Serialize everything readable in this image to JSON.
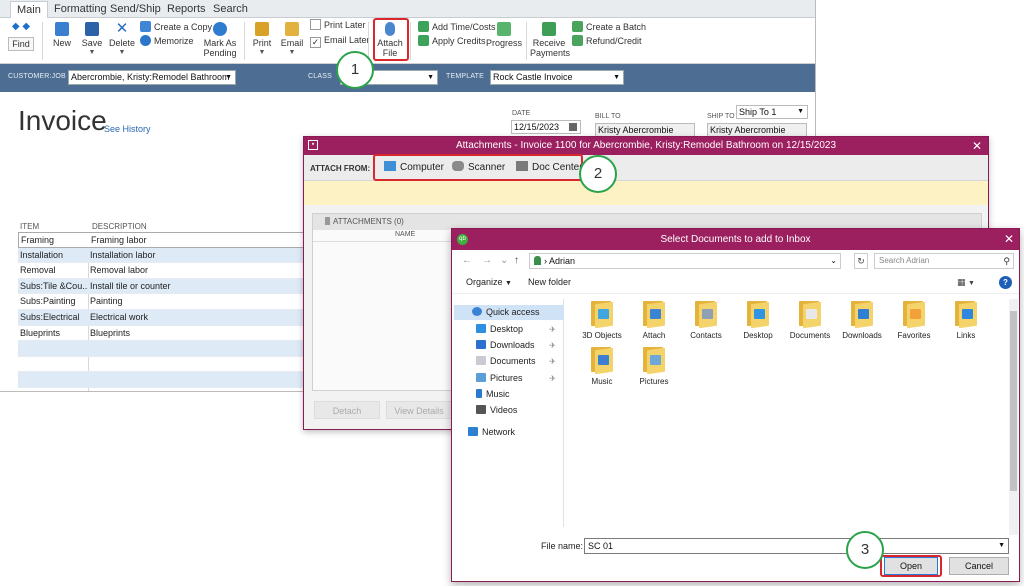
{
  "main": {
    "tabs": [
      "Main",
      "Formatting",
      "Send/Ship",
      "Reports",
      "Search"
    ],
    "ribbon": {
      "find": "Find",
      "new": "New",
      "save": "Save",
      "delete": "Delete",
      "create_copy": "Create a Copy",
      "memorize": "Memorize",
      "mark_as_pending": "Mark As Pending",
      "print": "Print",
      "email": "Email",
      "print_later": "Print Later",
      "email_later": "Email Later",
      "attach_file": "Attach File",
      "add_time_costs": "Add Time/Costs",
      "apply_credits": "Apply Credits",
      "progress": "Progress",
      "receive_payments": "Receive Payments",
      "create_batch": "Create a Batch",
      "refund_credit": "Refund/Credit"
    },
    "customer_label": "CUSTOMER:JOB",
    "customer_value": "Abercrombie, Kristy:Remodel Bathroom",
    "class_label": "CLASS",
    "template_label": "TEMPLATE",
    "template_value": "Rock Castle Invoice",
    "title": "Invoice",
    "see_history": "See History",
    "date_label": "DATE",
    "date_value": "12/15/2023",
    "bill_to_label": "BILL TO",
    "bill_to_value": "Kristy Abercrombie",
    "ship_to_label": "SHIP TO",
    "ship_to_select": "Ship To 1",
    "ship_to_value": "Kristy Abercrombie",
    "item_col": "ITEM",
    "desc_col": "DESCRIPTION",
    "items": [
      {
        "item": "Framing",
        "desc": "Framing labor"
      },
      {
        "item": "Installation",
        "desc": "Installation labor"
      },
      {
        "item": "Removal",
        "desc": "Removal labor"
      },
      {
        "item": "Subs:Tile &Cou...",
        "desc": "Install tile or counter"
      },
      {
        "item": "Subs:Painting",
        "desc": "Painting"
      },
      {
        "item": "Subs:Electrical",
        "desc": "Electrical work"
      },
      {
        "item": "Blueprints",
        "desc": "Blueprints"
      },
      {
        "item": "",
        "desc": ""
      },
      {
        "item": "",
        "desc": ""
      },
      {
        "item": "",
        "desc": ""
      }
    ]
  },
  "attachments": {
    "title": "Attachments - Invoice 1100 for Abercrombie, Kristy:Remodel Bathroom on 12/15/2023",
    "attach_from": "ATTACH FROM:",
    "computer": "Computer",
    "scanner": "Scanner",
    "doc_center": "Doc Center",
    "attachments_header": "ATTACHMENTS (0)",
    "name_col": "NAME",
    "detach": "Detach",
    "view_details": "View Details"
  },
  "dialog": {
    "title": "Select Documents to add to Inbox",
    "address": "Adrian",
    "search_placeholder": "Search Adrian",
    "organize": "Organize",
    "new_folder": "New folder",
    "nav": {
      "quick_access": "Quick access",
      "desktop": "Desktop",
      "downloads": "Downloads",
      "documents": "Documents",
      "pictures": "Pictures",
      "music": "Music",
      "videos": "Videos",
      "network": "Network"
    },
    "folders": [
      "3D Objects",
      "Attach",
      "Contacts",
      "Desktop",
      "Documents",
      "Downloads",
      "Favorites",
      "Links",
      "Music",
      "Pictures"
    ],
    "file_name_label": "File name:",
    "file_name_value": "SC 01",
    "open": "Open",
    "cancel": "Cancel"
  },
  "steps": [
    "1",
    "2",
    "3"
  ],
  "colors": {
    "title_bar": "#9c1f5f",
    "customer_bar": "#4d6e92",
    "highlight": "#d9272e",
    "step_ring": "#2aa34a"
  }
}
